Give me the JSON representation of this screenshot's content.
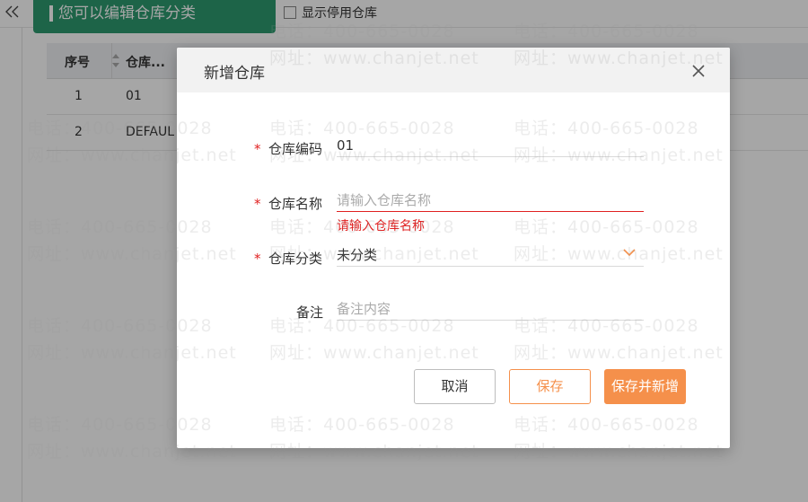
{
  "page": {
    "tip_banner": "您可以编辑仓库分类",
    "show_disabled_label": "显示停用仓库",
    "grid": {
      "columns": [
        "序号",
        "仓库..."
      ],
      "rows": [
        {
          "index": "1",
          "value": "01"
        },
        {
          "index": "2",
          "value": "DEFAUL"
        }
      ]
    }
  },
  "watermark": {
    "phone": "电话：400-665-0028",
    "site": "网址：www.chanjet.net"
  },
  "modal": {
    "title": "新增仓库",
    "fields": {
      "code": {
        "label": "仓库编码",
        "required_mark": "*",
        "value": "01"
      },
      "name": {
        "label": "仓库名称",
        "required_mark": "*",
        "value": "",
        "placeholder": "请输入仓库名称",
        "error": "请输入仓库名称"
      },
      "category": {
        "label": "仓库分类",
        "required_mark": "*",
        "value": "未分类"
      },
      "remark": {
        "label": "备注",
        "value": "",
        "placeholder": "备注内容"
      }
    },
    "buttons": {
      "cancel": "取消",
      "save": "保存",
      "save_new": "保存并新增"
    }
  },
  "colors": {
    "accent": "#f5904b",
    "error": "#e02020",
    "banner": "#2d9a6f"
  }
}
